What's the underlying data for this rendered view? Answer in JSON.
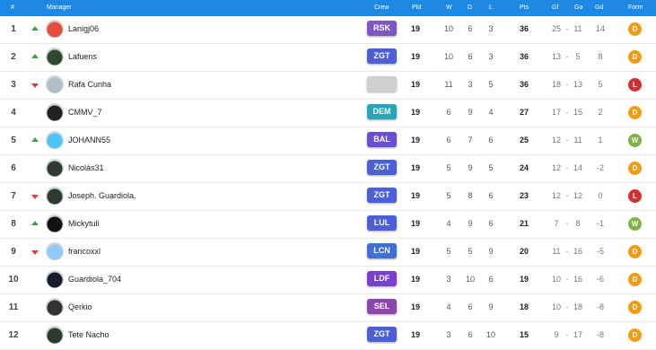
{
  "header": {
    "rank": "#",
    "manager": "Manager",
    "crew": "Crew",
    "pld": "Pld",
    "w": "W",
    "d": "D",
    "l": "L",
    "pts": "Pts",
    "gf": "Gf",
    "ga": "Ga",
    "gd": "Gd",
    "form": "Form"
  },
  "colors": {
    "header_bg": "#1e88e5",
    "up": "#43a047",
    "down": "#e53935",
    "form_D": "#f39c12",
    "form_W": "#7cb342",
    "form_L": "#d32f2f"
  },
  "rows": [
    {
      "rank": "1",
      "trend": "up",
      "name": "Lanigj06",
      "crew": "RSK",
      "crew_color": "#7e57c2",
      "pld": "19",
      "w": "10",
      "d": "6",
      "l": "3",
      "pts": "36",
      "gf": "25",
      "sep": "-",
      "ga": "11",
      "gd": "14",
      "form": "D",
      "avatar_color": "#e74c3c"
    },
    {
      "rank": "2",
      "trend": "up",
      "name": "Lafuens",
      "crew": "ZGT",
      "crew_color": "#4c5fd7",
      "pld": "19",
      "w": "10",
      "d": "6",
      "l": "3",
      "pts": "36",
      "gf": "13",
      "sep": "-",
      "ga": "5",
      "gd": "8",
      "form": "D",
      "avatar_color": "#2e4a2e"
    },
    {
      "rank": "3",
      "trend": "down",
      "name": "Rafa Cunha",
      "crew": "",
      "crew_color": "#d0d0d0",
      "pld": "19",
      "w": "11",
      "d": "3",
      "l": "5",
      "pts": "36",
      "gf": "18",
      "sep": "-",
      "ga": "13",
      "gd": "5",
      "form": "L",
      "avatar_color": "#b0bec5"
    },
    {
      "rank": "4",
      "trend": "",
      "name": "CMMV_7",
      "crew": "DEM",
      "crew_color": "#26a6b8",
      "pld": "19",
      "w": "6",
      "d": "9",
      "l": "4",
      "pts": "27",
      "gf": "17",
      "sep": "-",
      "ga": "15",
      "gd": "2",
      "form": "D",
      "avatar_color": "#222222"
    },
    {
      "rank": "5",
      "trend": "up",
      "name": "JOHANN55",
      "crew": "BAL",
      "crew_color": "#6a4fd6",
      "pld": "19",
      "w": "6",
      "d": "7",
      "l": "6",
      "pts": "25",
      "gf": "12",
      "sep": "-",
      "ga": "11",
      "gd": "1",
      "form": "W",
      "avatar_color": "#4fc3f7"
    },
    {
      "rank": "6",
      "trend": "",
      "name": "Nicolás31",
      "crew": "ZGT",
      "crew_color": "#4c5fd7",
      "pld": "19",
      "w": "5",
      "d": "9",
      "l": "5",
      "pts": "24",
      "gf": "12",
      "sep": "-",
      "ga": "14",
      "gd": "-2",
      "form": "D",
      "avatar_color": "#2e3a2e"
    },
    {
      "rank": "7",
      "trend": "down",
      "name": "Joseph. Guardiola.",
      "crew": "ZGT",
      "crew_color": "#4c5fd7",
      "pld": "19",
      "w": "5",
      "d": "8",
      "l": "6",
      "pts": "23",
      "gf": "12",
      "sep": "-",
      "ga": "12",
      "gd": "0",
      "form": "L",
      "avatar_color": "#2e3a2e"
    },
    {
      "rank": "8",
      "trend": "up",
      "name": "Mickytuli",
      "crew": "LUL",
      "crew_color": "#4c5fd7",
      "pld": "19",
      "w": "4",
      "d": "9",
      "l": "6",
      "pts": "21",
      "gf": "7",
      "sep": "-",
      "ga": "8",
      "gd": "-1",
      "form": "W",
      "avatar_color": "#111111"
    },
    {
      "rank": "9",
      "trend": "down",
      "name": "francoxxl",
      "crew": "LCN",
      "crew_color": "#3f6fd8",
      "pld": "19",
      "w": "5",
      "d": "5",
      "l": "9",
      "pts": "20",
      "gf": "11",
      "sep": "-",
      "ga": "16",
      "gd": "-5",
      "form": "D",
      "avatar_color": "#90caf9"
    },
    {
      "rank": "10",
      "trend": "",
      "name": "Guardiola_704",
      "crew": "LDF",
      "crew_color": "#7b3fd0",
      "pld": "19",
      "w": "3",
      "d": "10",
      "l": "6",
      "pts": "19",
      "gf": "10",
      "sep": "-",
      "ga": "16",
      "gd": "-6",
      "form": "D",
      "avatar_color": "#1a1a2e"
    },
    {
      "rank": "11",
      "trend": "",
      "name": "Qerkio",
      "crew": "SEL",
      "crew_color": "#8e44ad",
      "pld": "19",
      "w": "4",
      "d": "6",
      "l": "9",
      "pts": "18",
      "gf": "10",
      "sep": "-",
      "ga": "18",
      "gd": "-8",
      "form": "D",
      "avatar_color": "#333333"
    },
    {
      "rank": "12",
      "trend": "",
      "name": "Tete Nacho",
      "crew": "ZGT",
      "crew_color": "#4c5fd7",
      "pld": "19",
      "w": "3",
      "d": "6",
      "l": "10",
      "pts": "15",
      "gf": "9",
      "sep": "-",
      "ga": "17",
      "gd": "-8",
      "form": "D",
      "avatar_color": "#2e3a2e"
    }
  ]
}
